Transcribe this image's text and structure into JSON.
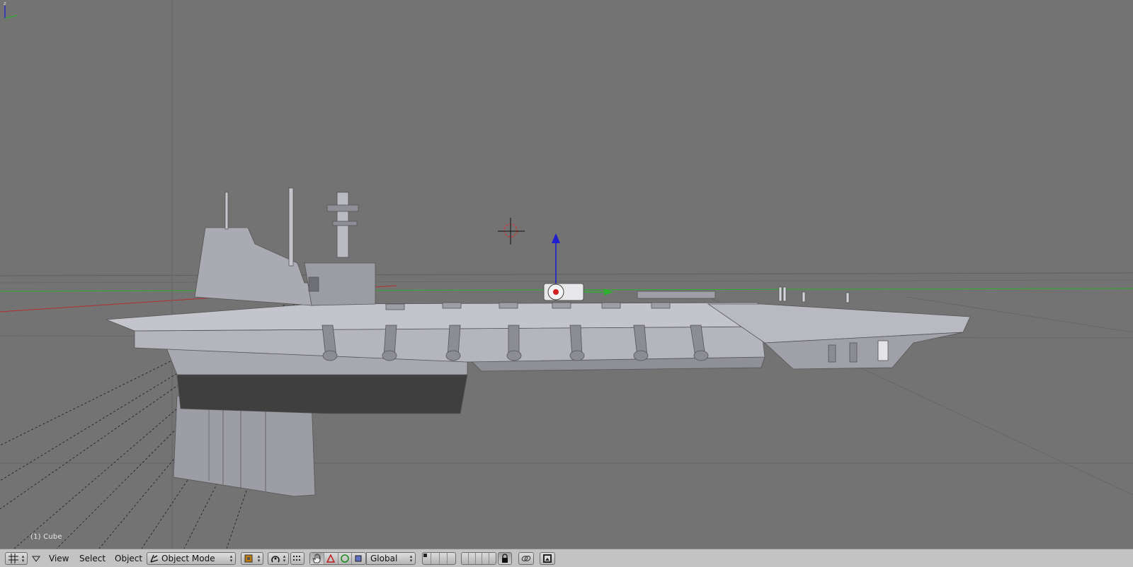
{
  "viewport": {
    "object_label": "(1) Cube",
    "mini_axis_label": "z"
  },
  "header": {
    "menus": {
      "view": "View",
      "select": "Select",
      "object": "Object"
    },
    "mode_select": {
      "selected": "Object Mode"
    },
    "orientation_select": {
      "selected": "Global"
    }
  },
  "colors": {
    "background": "#737373",
    "header": "#c3c3c3",
    "x_axis": "#b03030",
    "y_axis": "#2fae2f",
    "z_axis": "#1f1fd0",
    "mesh": "#a8a9b2"
  }
}
